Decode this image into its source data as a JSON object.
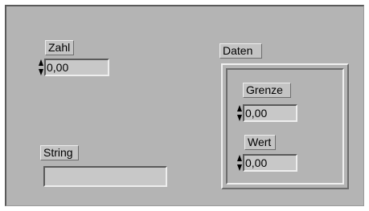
{
  "controls": {
    "zahl": {
      "label": "Zahl",
      "value": "0,00"
    },
    "string": {
      "label": "String",
      "value": ""
    },
    "daten": {
      "label": "Daten",
      "grenze": {
        "label": "Grenze",
        "value": "0,00"
      },
      "wert": {
        "label": "Wert",
        "value": "0,00"
      }
    }
  },
  "icons": {
    "increment": "up-arrow-icon",
    "decrement": "down-arrow-icon"
  },
  "colors": {
    "panel": "#b4b4b4",
    "field": "#c8c8c8",
    "label_bg": "#c4c4c4"
  }
}
